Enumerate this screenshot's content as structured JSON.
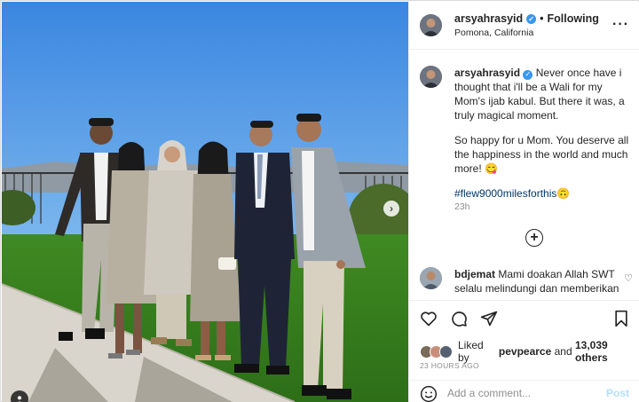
{
  "post": {
    "author": {
      "username": "arsyahrasyid",
      "verified": true,
      "follow_status": "Following",
      "location": "Pomona, California"
    },
    "caption": {
      "username": "arsyahrasyid",
      "text": "Never once have i thought that i'll be a Wali for my Mom's ijab kabul. But there it was, a truly magical moment.",
      "text2": "So happy for u Mom. You deserve all the happiness in the world and much more!",
      "emoji": "😋",
      "hashtag": "#flew9000milesforthis",
      "hashtag_emoji": "🙃",
      "time": "23h"
    },
    "comment": {
      "username": "bdjemat",
      "text": "Mami doakan Allah SWT selalu melindungi dan memberikan"
    },
    "likes": {
      "liked_by_prefix": "Liked by",
      "liked_by_user": "pevpearce",
      "and": "and",
      "others": "13,039 others"
    },
    "timestamp": "23 HOURS AGO",
    "add_comment": {
      "placeholder": "Add a comment...",
      "post_label": "Post"
    }
  },
  "icons": {
    "more": "more-options-icon",
    "verified": "verified-badge-icon",
    "like": "heart-icon",
    "comment": "comment-icon",
    "share": "paper-plane-icon",
    "save": "bookmark-icon",
    "emoji": "emoji-icon",
    "carousel_next": "chevron-right-icon",
    "tag": "user-tag-icon",
    "load_more": "plus-circle-icon"
  },
  "colors": {
    "verified": "#3897f0",
    "hashtag": "#00376b",
    "post_disabled": "#b2dffc",
    "muted": "#8e8e8e"
  }
}
